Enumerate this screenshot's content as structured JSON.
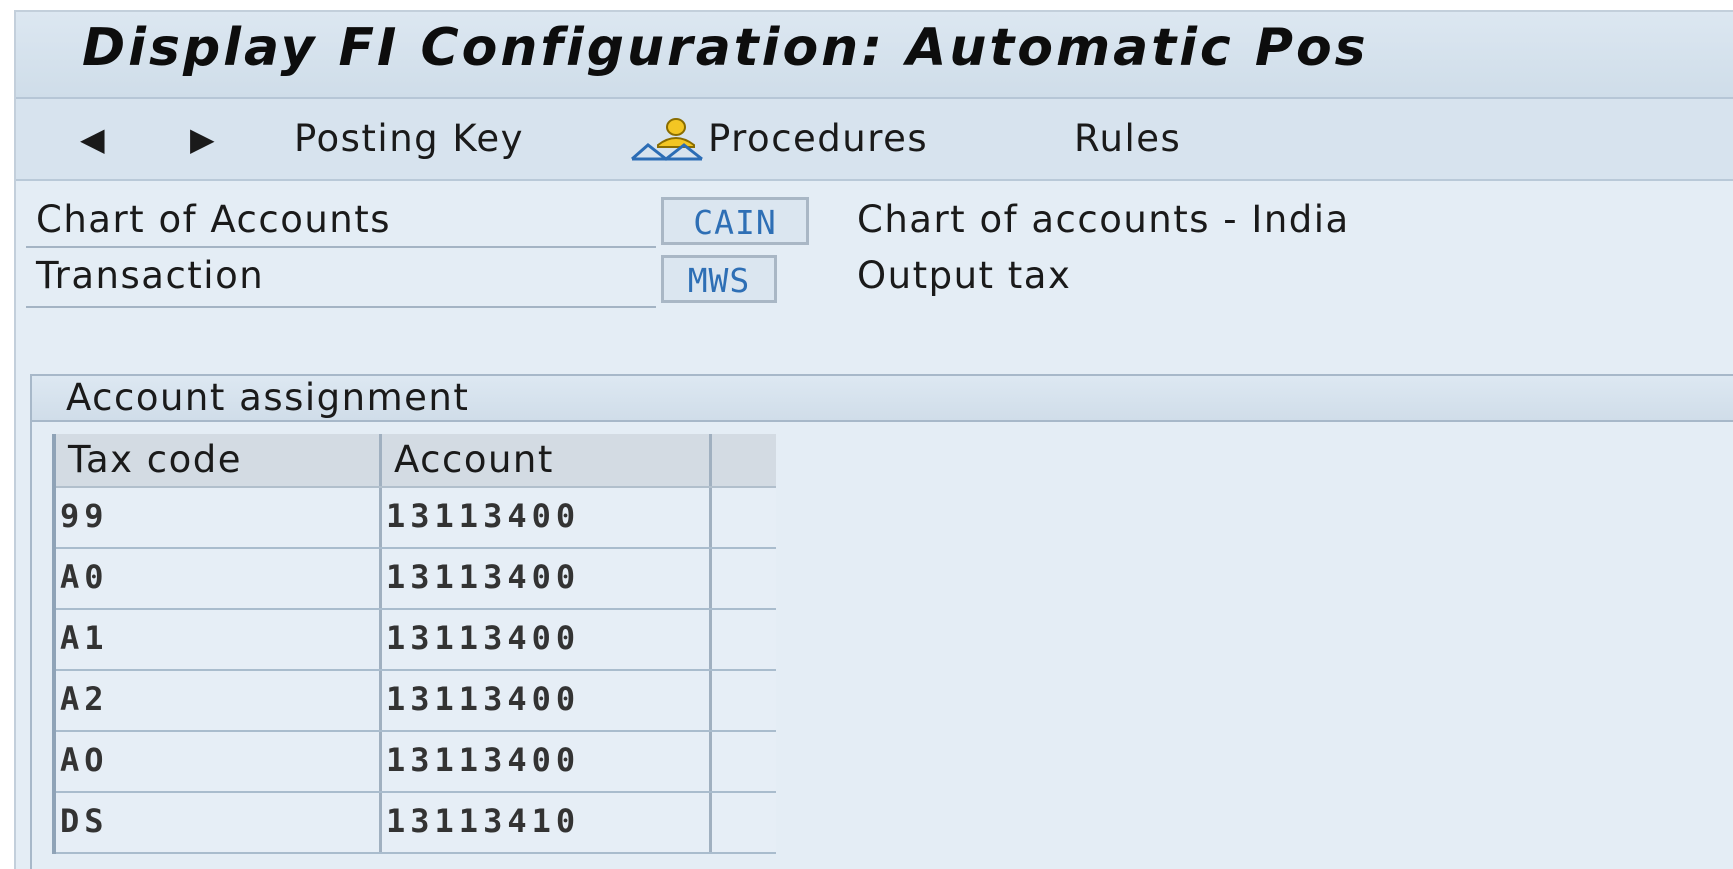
{
  "title_bar": {
    "title": "Display FI Configuration: Automatic Pos"
  },
  "toolbar": {
    "back_icon": "arrow-left-icon",
    "forward_icon": "arrow-right-icon",
    "posting_key_label": "Posting Key",
    "procedures_icon": "user-hierarchy-icon",
    "procedures_label": "Procedures",
    "rules_label": "Rules"
  },
  "header_fields": {
    "chart_of_accounts": {
      "label": "Chart of Accounts",
      "value": "CAIN",
      "description": "Chart of accounts - India"
    },
    "transaction": {
      "label": "Transaction",
      "value": "MWS",
      "description": "Output tax"
    }
  },
  "account_assignment": {
    "title": "Account assignment",
    "columns": [
      "Tax code",
      "Account"
    ],
    "rows": [
      {
        "tax_code": "99",
        "account": "13113400"
      },
      {
        "tax_code": "A0",
        "account": "13113400"
      },
      {
        "tax_code": "A1",
        "account": "13113400"
      },
      {
        "tax_code": "A2",
        "account": "13113400"
      },
      {
        "tax_code": "AO",
        "account": "13113400"
      },
      {
        "tax_code": "DS",
        "account": "13113410"
      }
    ]
  },
  "colors": {
    "background": "#e4edf5",
    "field_value_text": "#2e6fb5",
    "title_bar": "#d3e0ec"
  }
}
